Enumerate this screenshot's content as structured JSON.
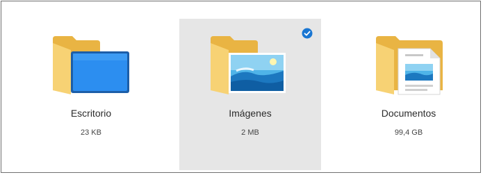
{
  "folders": [
    {
      "name": "Escritorio",
      "size": "23 KB",
      "selected": false,
      "icon": "desktop-folder-icon"
    },
    {
      "name": "Imágenes",
      "size": "2 MB",
      "selected": true,
      "icon": "pictures-folder-icon"
    },
    {
      "name": "Documentos",
      "size": "99,4 GB",
      "selected": false,
      "icon": "documents-folder-icon"
    }
  ],
  "colors": {
    "selection_background": "#e6e6e6",
    "check_accent": "#1976d2",
    "folder_yellow": "#f4c95d"
  }
}
